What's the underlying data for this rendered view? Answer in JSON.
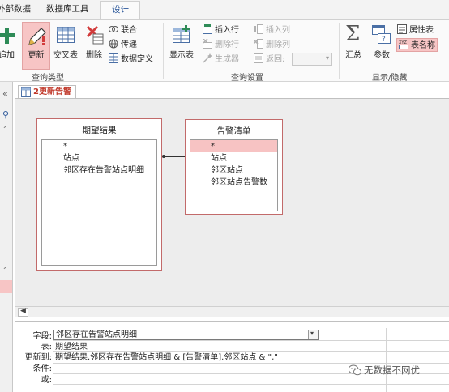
{
  "tabs": [
    "外部数据",
    "数据库工具",
    "设计"
  ],
  "ribbon": {
    "query_type": {
      "label": "查询类型",
      "append": "追加",
      "update": "更新",
      "crosstab": "交叉表",
      "delete": "删除",
      "union": "联合",
      "passthrough": "传递",
      "data_definition": "数据定义"
    },
    "query_setup": {
      "label": "查询设置",
      "show_table": "显示表",
      "insert_rows": "插入行",
      "delete_rows": "删除行",
      "builder": "生成器",
      "insert_columns": "插入列",
      "delete_columns": "删除列",
      "return": "返回:"
    },
    "show_hide": {
      "label": "显示/隐藏",
      "totals": "汇总",
      "parameters": "参数",
      "property_sheet": "属性表",
      "table_names": "表名称"
    }
  },
  "document": {
    "tab_label": "2更新告警"
  },
  "tables": [
    {
      "title": "期望结果",
      "fields": [
        "*",
        "站点",
        "邻区存在告警站点明细"
      ]
    },
    {
      "title": "告警清单",
      "fields": [
        "*",
        "站点",
        "邻区站点",
        "邻区站点告警数"
      ]
    }
  ],
  "grid": {
    "row_labels": [
      "字段:",
      "表:",
      "更新到:",
      "条件:",
      "或:"
    ],
    "field": "邻区存在告警站点明细",
    "table": "期望结果",
    "update_to": "期望结果.邻区存在告警站点明细 & [告警清单].邻区站点 & \",\""
  },
  "watermark": "无数据不网优"
}
